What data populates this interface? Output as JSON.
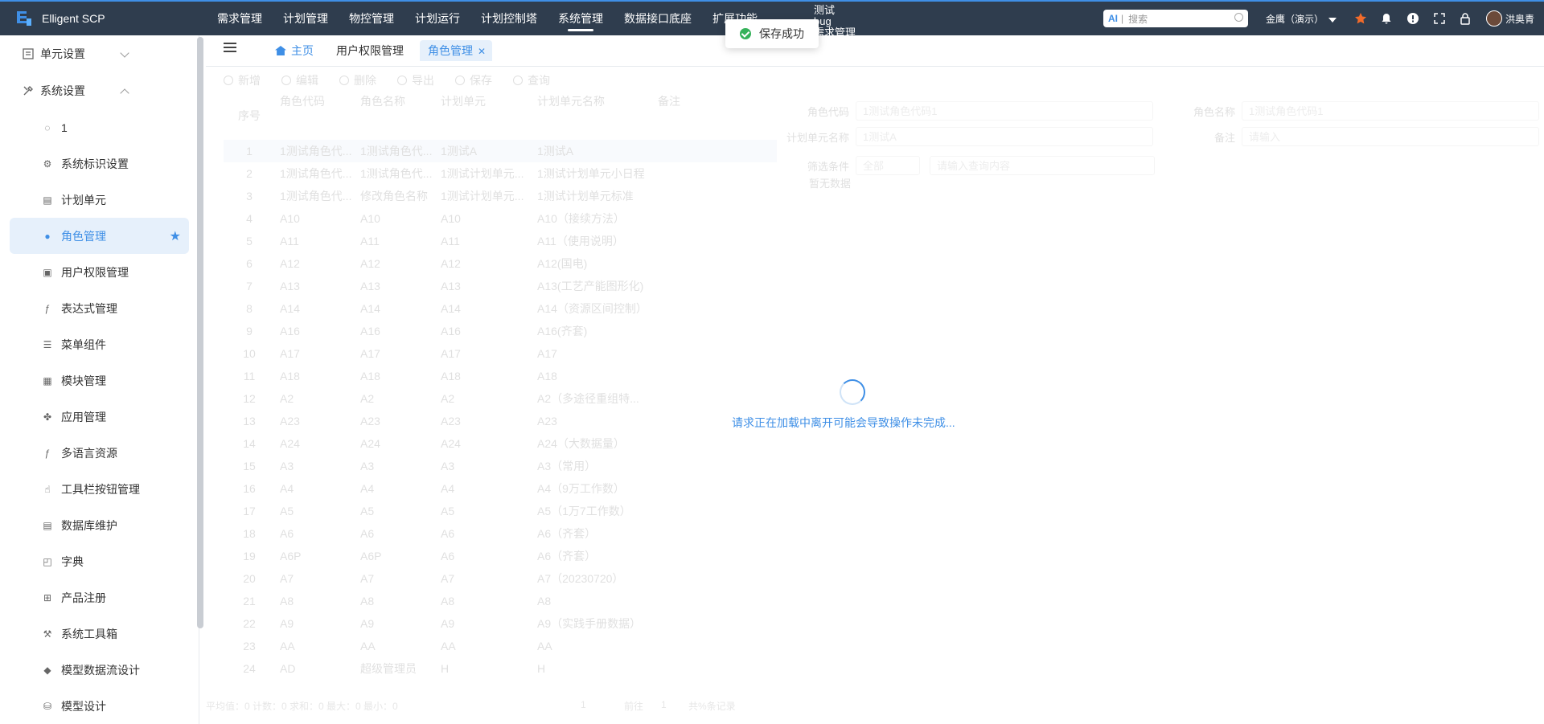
{
  "app": {
    "title": "Elligent SCP"
  },
  "nav": {
    "items": [
      "需求管理",
      "计划管理",
      "物控管理",
      "计划运行",
      "计划控制塔",
      "系统管理",
      "数据接口底座",
      "扩展功能"
    ],
    "active": "系统管理",
    "stacked": [
      "测试",
      "bug",
      "需求管理"
    ]
  },
  "search": {
    "ai": "AI",
    "placeholder": "搜索"
  },
  "tenant": "金鹰（演示）",
  "user": {
    "name": "洪奥青"
  },
  "icons": [
    "star-icon",
    "bell-icon",
    "alert-icon",
    "fullscreen-icon",
    "lock-icon"
  ],
  "sidebar": {
    "groups": [
      {
        "label": "单元设置",
        "icon": "unit-settings-icon",
        "expanded": false
      },
      {
        "label": "系统设置",
        "icon": "tools-icon",
        "expanded": true
      }
    ],
    "items": [
      {
        "label": "1",
        "icon": "refresh-icon"
      },
      {
        "label": "系统标识设置",
        "icon": "gear-icon"
      },
      {
        "label": "计划单元",
        "icon": "calculator-icon"
      },
      {
        "label": "角色管理",
        "icon": "user-icon",
        "active": true
      },
      {
        "label": "用户权限管理",
        "icon": "lock-icon"
      },
      {
        "label": "表达式管理",
        "icon": "function-icon"
      },
      {
        "label": "菜单组件",
        "icon": "list-icon"
      },
      {
        "label": "模块管理",
        "icon": "module-icon"
      },
      {
        "label": "应用管理",
        "icon": "apps-icon"
      },
      {
        "label": "多语言资源",
        "icon": "function-icon"
      },
      {
        "label": "工具栏按钮管理",
        "icon": "hand-icon"
      },
      {
        "label": "数据库维护",
        "icon": "database-icon"
      },
      {
        "label": "字典",
        "icon": "dictionary-icon"
      },
      {
        "label": "产品注册",
        "icon": "register-icon"
      },
      {
        "label": "系统工具箱",
        "icon": "toolbox-icon"
      },
      {
        "label": "模型数据流设计",
        "icon": "cube-icon"
      },
      {
        "label": "模型设计",
        "icon": "database-icon"
      }
    ]
  },
  "tabs": {
    "home": "主页",
    "perm": "用户权限管理",
    "role": "角色管理"
  },
  "toolbar": [
    "新增",
    "编辑",
    "删除",
    "导出",
    "保存",
    "查询"
  ],
  "grid": {
    "headers": [
      "序号",
      "角色代码",
      "角色名称",
      "计划单元",
      "计划单元名称",
      "备注"
    ],
    "rows": [
      [
        "1",
        "1测试角色代...",
        "1测试角色代...",
        "1测试A",
        "1测试A",
        ""
      ],
      [
        "2",
        "1测试角色代...",
        "1测试角色代...",
        "1测试计划单元...",
        "1测试计划单元小日程",
        ""
      ],
      [
        "3",
        "1测试角色代...",
        "修改角色名称",
        "1测试计划单元...",
        "1测试计划单元标准",
        ""
      ],
      [
        "4",
        "A10",
        "A10",
        "A10",
        "A10（接续方法）",
        ""
      ],
      [
        "5",
        "A11",
        "A11",
        "A11",
        "A11（使用说明）",
        ""
      ],
      [
        "6",
        "A12",
        "A12",
        "A12",
        "A12(国电)",
        ""
      ],
      [
        "7",
        "A13",
        "A13",
        "A13",
        "A13(工艺产能图形化)",
        ""
      ],
      [
        "8",
        "A14",
        "A14",
        "A14",
        "A14（资源区间控制）",
        ""
      ],
      [
        "9",
        "A16",
        "A16",
        "A16",
        "A16(齐套)",
        ""
      ],
      [
        "10",
        "A17",
        "A17",
        "A17",
        "A17",
        ""
      ],
      [
        "11",
        "A18",
        "A18",
        "A18",
        "A18",
        ""
      ],
      [
        "12",
        "A2",
        "A2",
        "A2",
        "A2（多途径重组特...",
        ""
      ],
      [
        "13",
        "A23",
        "A23",
        "A23",
        "A23",
        ""
      ],
      [
        "14",
        "A24",
        "A24",
        "A24",
        "A24（大数据量）",
        ""
      ],
      [
        "15",
        "A3",
        "A3",
        "A3",
        "A3（常用）",
        ""
      ],
      [
        "16",
        "A4",
        "A4",
        "A4",
        "A4（9万工作数）",
        ""
      ],
      [
        "17",
        "A5",
        "A5",
        "A5",
        "A5（1万7工作数）",
        ""
      ],
      [
        "18",
        "A6",
        "A6",
        "A6",
        "A6（齐套）",
        ""
      ],
      [
        "19",
        "A6P",
        "A6P",
        "A6",
        "A6（齐套）",
        ""
      ],
      [
        "20",
        "A7",
        "A7",
        "A7",
        "A7（20230720）",
        ""
      ],
      [
        "21",
        "A8",
        "A8",
        "A8",
        "A8",
        ""
      ],
      [
        "22",
        "A9",
        "A9",
        "A9",
        "A9（实践手册数据）",
        ""
      ],
      [
        "23",
        "AA",
        "AA",
        "AA",
        "AA",
        ""
      ],
      [
        "24",
        "AD",
        "超级管理员",
        "H",
        "H",
        ""
      ]
    ]
  },
  "form": {
    "role_code": {
      "label": "角色代码",
      "value": "1测试角色代码1"
    },
    "role_name": {
      "label": "角色名称",
      "value": "1测试角色代码1"
    },
    "unit_name": {
      "label": "计划单元名称",
      "value": "1测试A"
    },
    "remark": {
      "label": "备注",
      "placeholder": "请输入"
    },
    "filter": {
      "label": "筛选条件",
      "value": "全部",
      "placeholder": "请输入查询内容",
      "empty": "暂无数据"
    }
  },
  "footer": {
    "stats": "平均值：0 计数：0 求和：0 最大：0 最小：0",
    "page": "1",
    "goto": "前往",
    "goto_page": "1",
    "total": "共%条记录"
  },
  "loading": {
    "text": "请求正在加载中离开可能会导致操作未完成..."
  },
  "toast": {
    "text": "保存成功"
  }
}
